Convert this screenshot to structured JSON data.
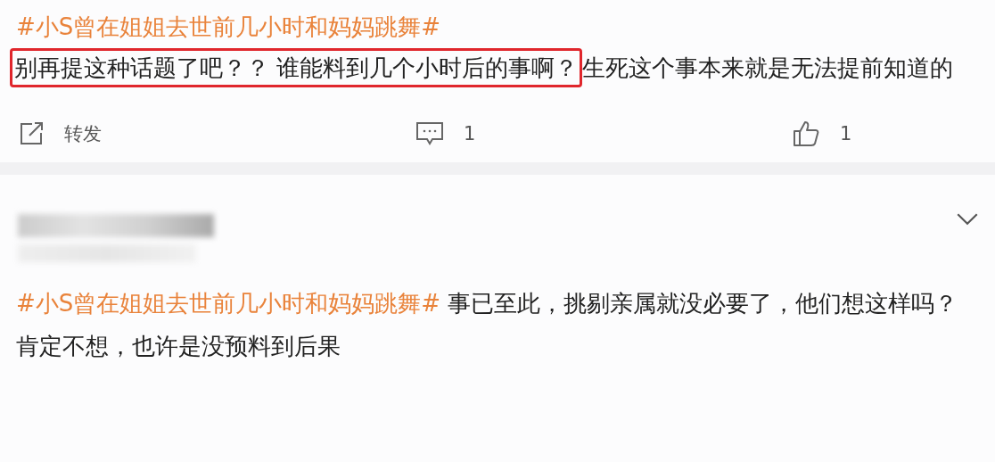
{
  "posts": [
    {
      "kind": "quoted",
      "hashtag": "#小S曾在姐姐去世前几小时和妈妈跳舞#",
      "highlighted": "别再提这种话题了吧？？ 谁能料到几个小时后的事啊？",
      "text": "生死这个事本来就是无法提前知道的",
      "actions": [
        {
          "kind": "repost",
          "label": "转发"
        },
        {
          "kind": "comment",
          "label": "1"
        },
        {
          "kind": "like",
          "label": "1"
        }
      ]
    },
    {
      "kind": "reply",
      "hashtag": "#小S曾在姐姐去世前几小时和妈妈跳舞#",
      "text": "事已至此，挑剔亲属就没必要了，他们想这样吗？肯定不想，也许是没预料到后果"
    }
  ]
}
